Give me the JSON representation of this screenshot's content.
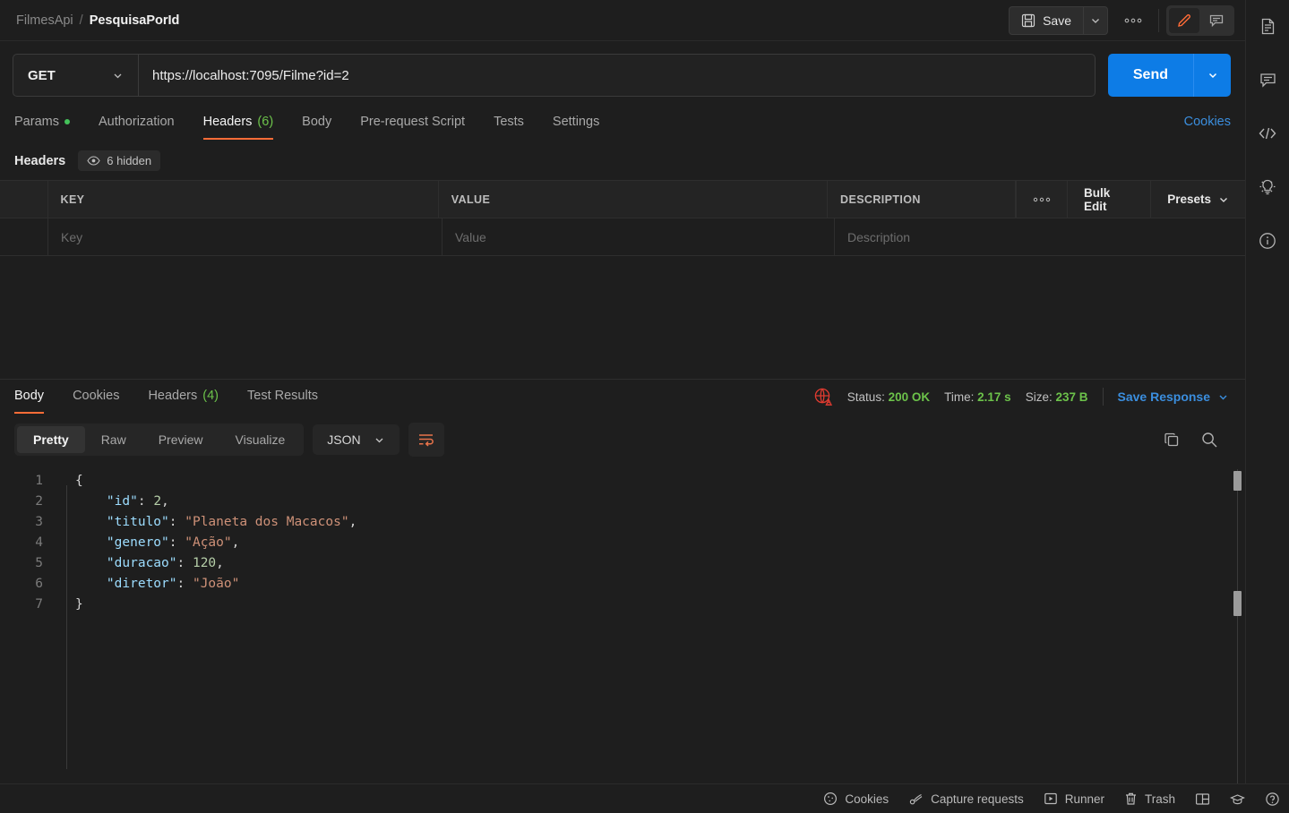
{
  "breadcrumb": {
    "root": "FilmesApi",
    "separator": "/",
    "current": "PesquisaPorId"
  },
  "topbar": {
    "save_label": "Save",
    "save_caret_icon": "chevron-down-icon",
    "more_icon": "ellipsis-icon",
    "edit_icon": "pencil-icon",
    "comment_icon": "comment-icon",
    "accent": "#ff6c37"
  },
  "request": {
    "method": "GET",
    "url": "https://localhost:7095/Filme?id=2",
    "send_label": "Send",
    "send_color": "#0d7ce6",
    "tabs": [
      {
        "label": "Params",
        "dot": true,
        "active": false
      },
      {
        "label": "Authorization",
        "active": false
      },
      {
        "label": "Headers",
        "count": "(6)",
        "active": true
      },
      {
        "label": "Body",
        "active": false
      },
      {
        "label": "Pre-request Script",
        "active": false
      },
      {
        "label": "Tests",
        "active": false
      },
      {
        "label": "Settings",
        "active": false
      }
    ],
    "cookies_link": "Cookies",
    "headers_section_title": "Headers",
    "hidden_pill": "6 hidden",
    "table": {
      "columns": [
        "KEY",
        "VALUE",
        "DESCRIPTION"
      ],
      "actions": {
        "dots": "○○○",
        "bulk_edit": "Bulk Edit",
        "presets": "Presets"
      },
      "empty_row": {
        "key": "Key",
        "value": "Value",
        "description": "Description"
      }
    }
  },
  "response": {
    "tabs": [
      {
        "label": "Body",
        "active": true
      },
      {
        "label": "Cookies",
        "active": false
      },
      {
        "label": "Headers",
        "count": "(4)",
        "active": false
      },
      {
        "label": "Test Results",
        "active": false
      }
    ],
    "cert_icon": "globe-warning-icon",
    "status_label": "Status:",
    "status_value": "200 OK",
    "time_label": "Time:",
    "time_value": "2.17 s",
    "size_label": "Size:",
    "size_value": "237 B",
    "save_response": "Save Response",
    "status_color": "#6cc24a",
    "format_tabs": [
      {
        "label": "Pretty",
        "active": true
      },
      {
        "label": "Raw",
        "active": false
      },
      {
        "label": "Preview",
        "active": false
      },
      {
        "label": "Visualize",
        "active": false
      }
    ],
    "language": "JSON",
    "wrap_icon": "word-wrap-icon",
    "copy_icon": "copy-icon",
    "search_icon": "search-icon",
    "body_lines": [
      {
        "n": "1",
        "tokens": [
          {
            "t": "{",
            "c": "p"
          }
        ]
      },
      {
        "n": "2",
        "tokens": [
          {
            "t": "    ",
            "c": "p"
          },
          {
            "t": "\"id\"",
            "c": "k"
          },
          {
            "t": ": ",
            "c": "p"
          },
          {
            "t": "2",
            "c": "n"
          },
          {
            "t": ",",
            "c": "p"
          }
        ]
      },
      {
        "n": "3",
        "tokens": [
          {
            "t": "    ",
            "c": "p"
          },
          {
            "t": "\"titulo\"",
            "c": "k"
          },
          {
            "t": ": ",
            "c": "p"
          },
          {
            "t": "\"Planeta dos Macacos\"",
            "c": "s"
          },
          {
            "t": ",",
            "c": "p"
          }
        ]
      },
      {
        "n": "4",
        "tokens": [
          {
            "t": "    ",
            "c": "p"
          },
          {
            "t": "\"genero\"",
            "c": "k"
          },
          {
            "t": ": ",
            "c": "p"
          },
          {
            "t": "\"Ação\"",
            "c": "s"
          },
          {
            "t": ",",
            "c": "p"
          }
        ]
      },
      {
        "n": "5",
        "tokens": [
          {
            "t": "    ",
            "c": "p"
          },
          {
            "t": "\"duracao\"",
            "c": "k"
          },
          {
            "t": ": ",
            "c": "p"
          },
          {
            "t": "120",
            "c": "n"
          },
          {
            "t": ",",
            "c": "p"
          }
        ]
      },
      {
        "n": "6",
        "tokens": [
          {
            "t": "    ",
            "c": "p"
          },
          {
            "t": "\"diretor\"",
            "c": "k"
          },
          {
            "t": ": ",
            "c": "p"
          },
          {
            "t": "\"João\"",
            "c": "s"
          }
        ]
      },
      {
        "n": "7",
        "tokens": [
          {
            "t": "}",
            "c": "p"
          }
        ]
      }
    ]
  },
  "rail": [
    {
      "icon": "document-icon"
    },
    {
      "icon": "comment-icon"
    },
    {
      "icon": "code-icon"
    },
    {
      "icon": "lightbulb-icon"
    },
    {
      "icon": "info-icon"
    }
  ],
  "statusbar": [
    {
      "icon": "cookie-icon",
      "label": "Cookies"
    },
    {
      "icon": "capture-icon",
      "label": "Capture requests"
    },
    {
      "icon": "runner-icon",
      "label": "Runner"
    },
    {
      "icon": "trash-icon",
      "label": "Trash"
    },
    {
      "icon": "layout-icon",
      "label": ""
    },
    {
      "icon": "graduation-cap-icon",
      "label": ""
    },
    {
      "icon": "help-icon",
      "label": ""
    }
  ]
}
